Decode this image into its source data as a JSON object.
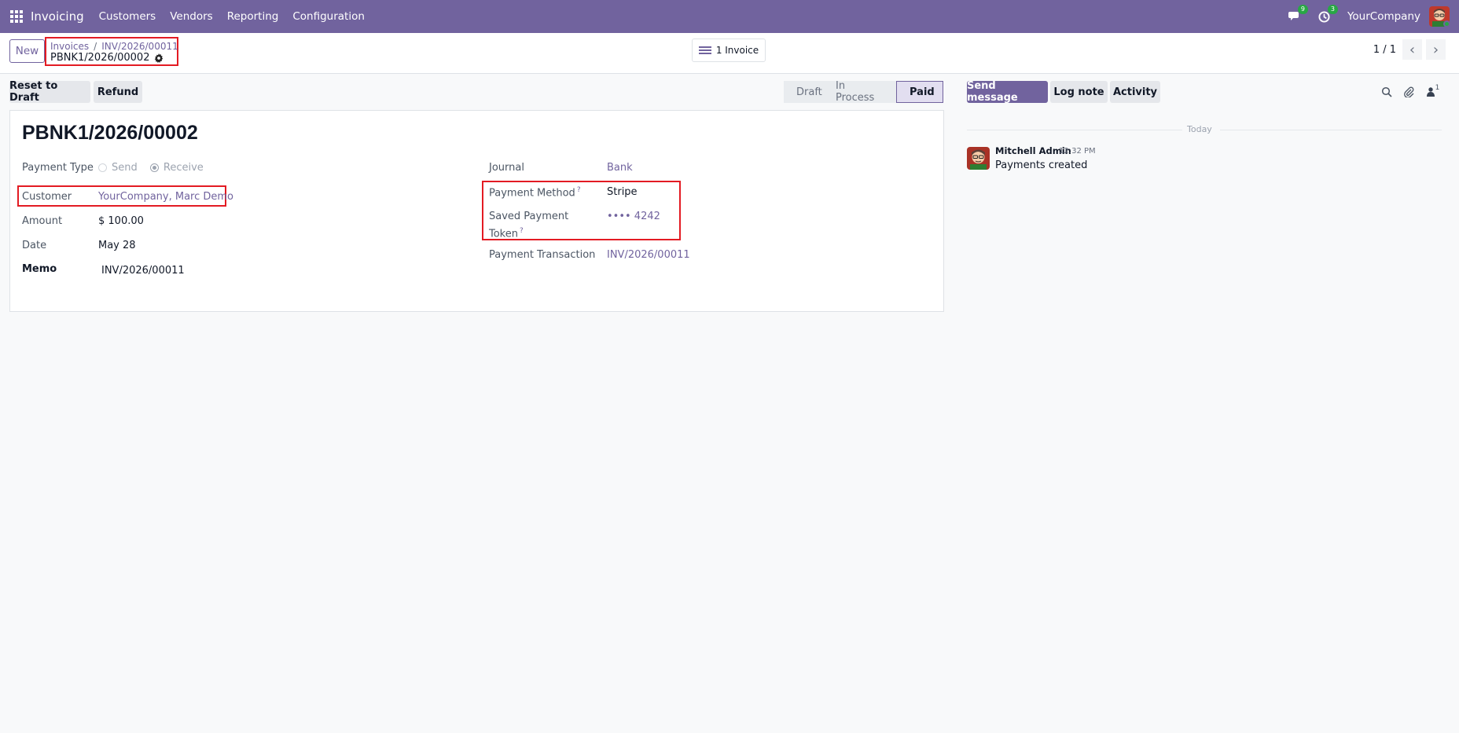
{
  "navbar": {
    "app_name": "Invoicing",
    "menu": [
      "Customers",
      "Vendors",
      "Reporting",
      "Configuration"
    ],
    "messages_count": "9",
    "activities_count": "3",
    "company": "YourCompany",
    "color": "#71639e"
  },
  "control_panel": {
    "new_label": "New",
    "breadcrumb": [
      "Invoices",
      "INV/2026/00011"
    ],
    "current_record": "PBNK1/2026/00002",
    "smart_button_label": "1 Invoice",
    "pager": "1 / 1"
  },
  "actions": {
    "reset_to_draft": "Reset to Draft",
    "refund": "Refund"
  },
  "statusbar": {
    "steps": [
      "Draft",
      "In Process",
      "Paid"
    ],
    "current": "Paid"
  },
  "form": {
    "title": "PBNK1/2026/00002",
    "payment_type": {
      "label": "Payment Type",
      "options": [
        "Send",
        "Receive"
      ],
      "selected": "Receive"
    },
    "customer": {
      "label": "Customer",
      "value": "YourCompany, Marc Demo"
    },
    "amount": {
      "label": "Amount",
      "value": "$ 100.00"
    },
    "date": {
      "label": "Date",
      "value": "May 28"
    },
    "memo": {
      "label": "Memo",
      "value": "INV/2026/00011"
    },
    "journal": {
      "label": "Journal",
      "value": "Bank"
    },
    "payment_method": {
      "label": "Payment Method",
      "value": "Stripe"
    },
    "saved_payment_token": {
      "label_line1": "Saved Payment",
      "label_line2": "Token",
      "value": "•••• 4242"
    },
    "payment_transaction": {
      "label": "Payment Transaction",
      "value": "INV/2026/00011"
    }
  },
  "chatter": {
    "send_message": "Send message",
    "log_note": "Log note",
    "activity": "Activity",
    "followers_count": "1",
    "date_separator": "Today",
    "messages": [
      {
        "author": "Mitchell Admin",
        "time": "12:32 PM",
        "body": "Payments created"
      }
    ]
  }
}
